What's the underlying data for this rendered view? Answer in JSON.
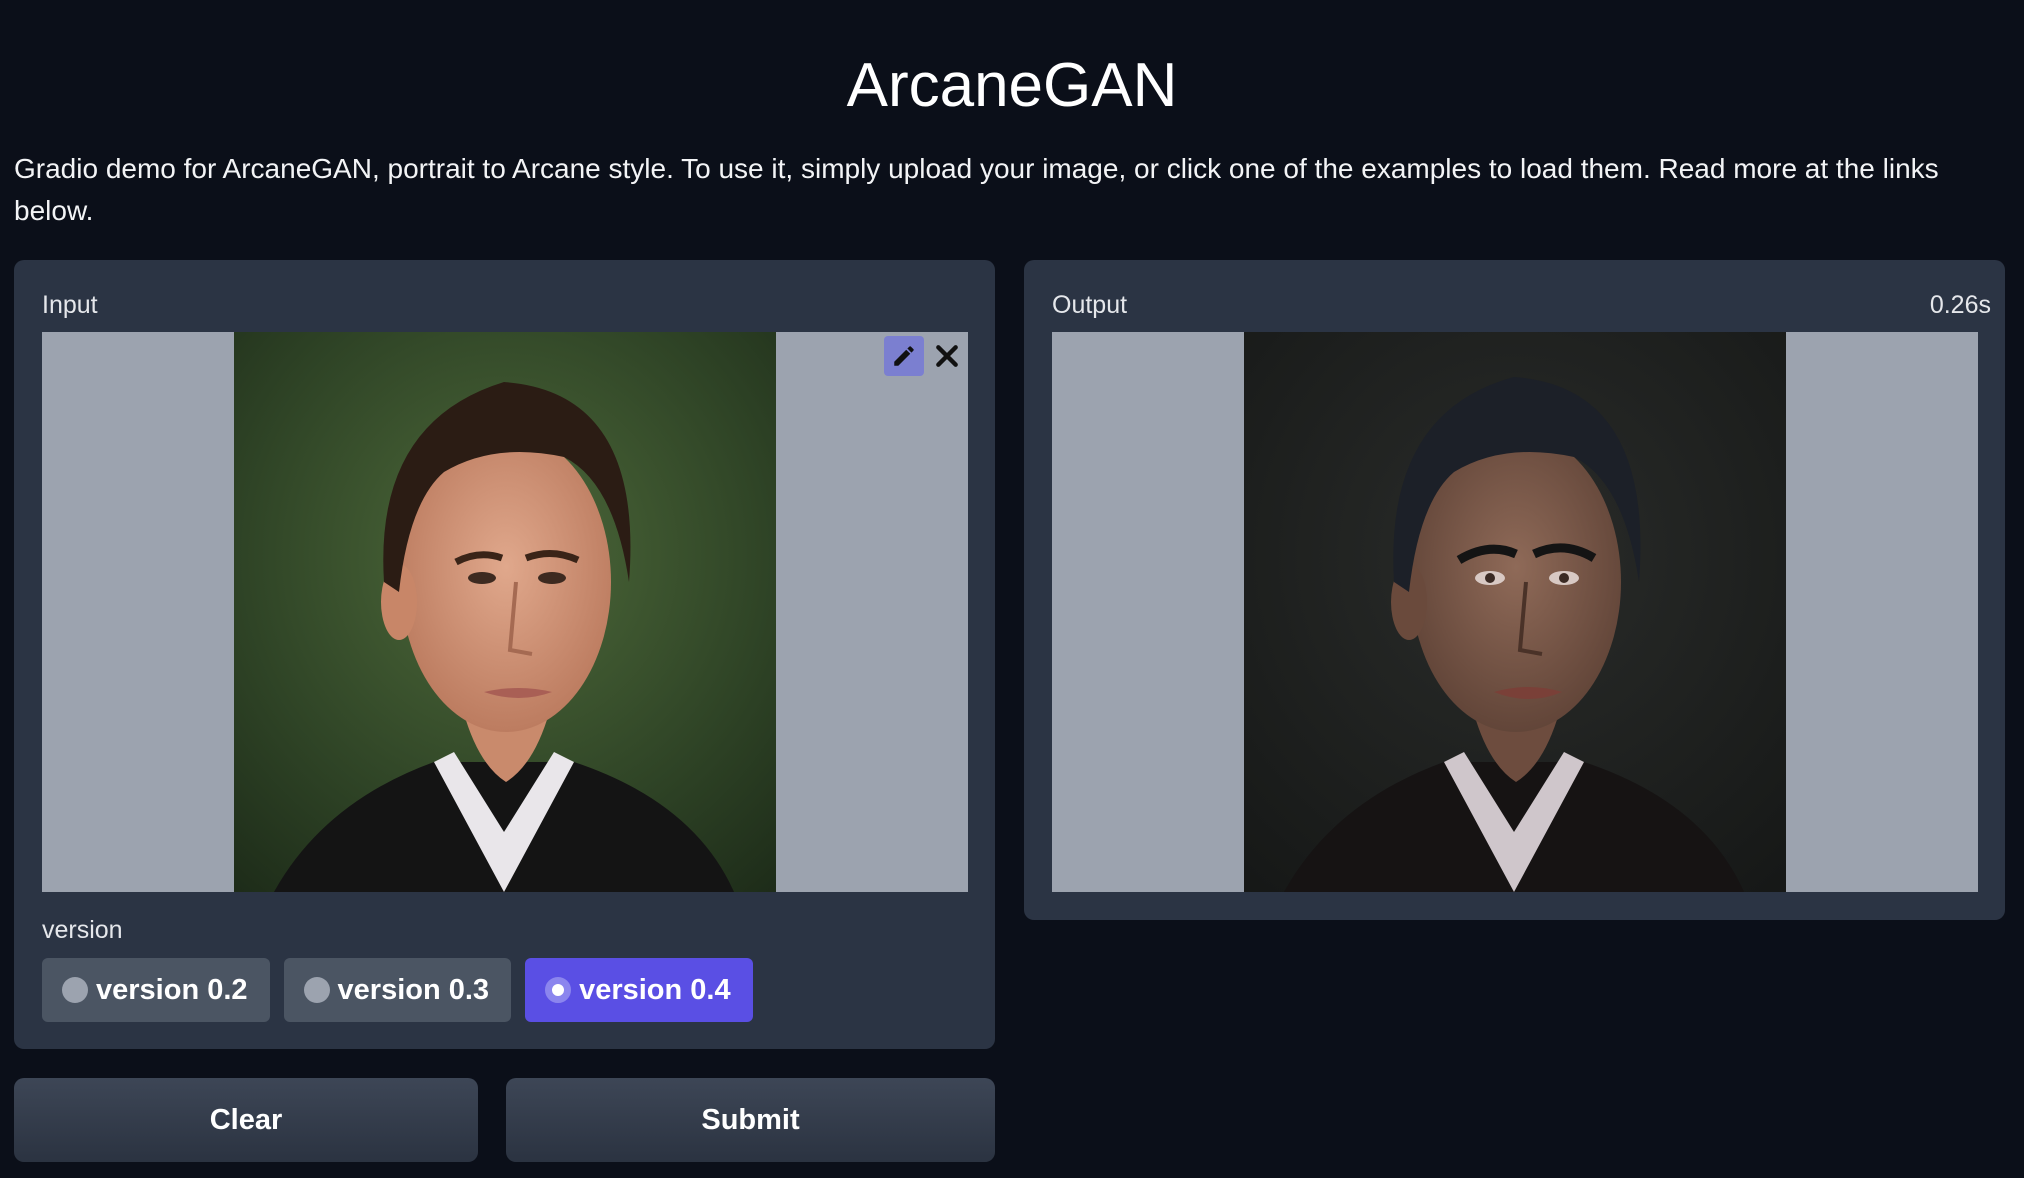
{
  "app": {
    "title": "ArcaneGAN",
    "description": "Gradio demo for ArcaneGAN, portrait to Arcane style. To use it, simply upload your image, or click one of the examples to load them. Read more at the links below."
  },
  "input_panel": {
    "label": "Input",
    "tools": [
      "pencil-icon",
      "close-icon"
    ],
    "version": {
      "label": "version",
      "options": [
        "version 0.2",
        "version 0.3",
        "version 0.4"
      ],
      "selected": "version 0.4"
    }
  },
  "output_panel": {
    "label": "Output",
    "timing": "0.26s"
  },
  "buttons": {
    "clear": "Clear",
    "submit": "Submit"
  },
  "colors": {
    "background": "#0b0f19",
    "panel": "#2b3444",
    "accent": "#5a4fe4"
  }
}
